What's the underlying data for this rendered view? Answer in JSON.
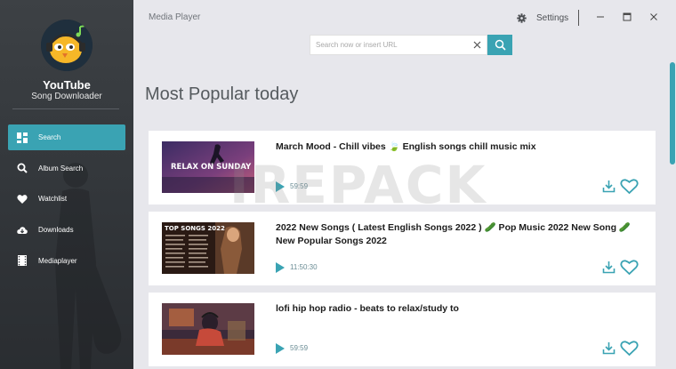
{
  "app": {
    "name": "YouTube",
    "subtitle": "Song Downloader",
    "window_title": "Media Player",
    "settings_label": "Settings"
  },
  "sidebar": {
    "items": [
      {
        "label": "Search",
        "icon": "search-grid-icon",
        "active": true
      },
      {
        "label": "Album Search",
        "icon": "search-icon",
        "active": false
      },
      {
        "label": "Watchlist",
        "icon": "heart-icon",
        "active": false
      },
      {
        "label": "Downloads",
        "icon": "cloud-download-icon",
        "active": false
      },
      {
        "label": "Mediaplayer",
        "icon": "film-icon",
        "active": false
      }
    ]
  },
  "search": {
    "placeholder": "Search now or insert URL",
    "value": ""
  },
  "main": {
    "heading": "Most Popular today",
    "results": [
      {
        "title": "March Mood - Chill vibes 🍃 English songs chill music mix",
        "duration": "59:59",
        "thumbnail_text": "RELAX ON SUNDAY"
      },
      {
        "title": "2022 New Songs ( Latest English Songs 2022 ) 🥒 Pop Music 2022 New Song 🥒 New Popular Songs 2022",
        "duration": "11:50:30",
        "thumbnail_text": "TOP SONGS 2022"
      },
      {
        "title": "lofi hip hop radio - beats to relax/study to",
        "duration": "59:59",
        "thumbnail_text": ""
      }
    ]
  },
  "watermark": "IREPACK",
  "colors": {
    "accent": "#3aa3b3",
    "sidebar_bg": "#3d4145",
    "content_bg": "#e7e7ec"
  }
}
